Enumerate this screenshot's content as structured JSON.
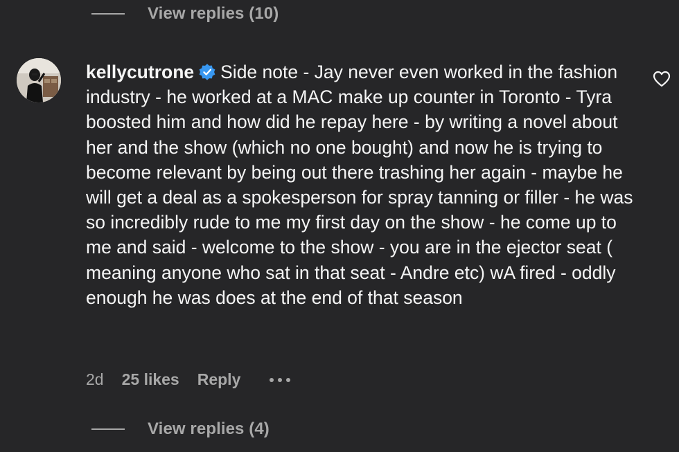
{
  "replies_top": {
    "label": "View replies (10)"
  },
  "comment": {
    "username": "kellycutrone",
    "verified": true,
    "text": "Side note - Jay never even worked in the fashion industry - he worked at a MAC make up counter in Toronto - Tyra boosted him and how did he repay here - by writing a novel about her and the show (which no one bought) and now he is trying to become relevant by being out there trashing her again - maybe he will get a deal as a spokesperson for spray tanning or filler - he was so incredibly rude to me my first day on the show - he come up to me and said - welcome to the show - you are in the ejector seat ( meaning anyone who sat in that seat - Andre etc) wA fired - oddly enough he was does at the end of that season",
    "time": "2d",
    "likes": "25 likes",
    "reply_label": "Reply",
    "more_icon": "more-horizontal-icon",
    "like_icon": "heart-outline-icon"
  },
  "replies_bottom": {
    "label": "View replies (4)"
  },
  "colors": {
    "background": "#262628",
    "text": "#f5f5f5",
    "secondary": "#a8a8a8",
    "verified": "#3897f0"
  }
}
